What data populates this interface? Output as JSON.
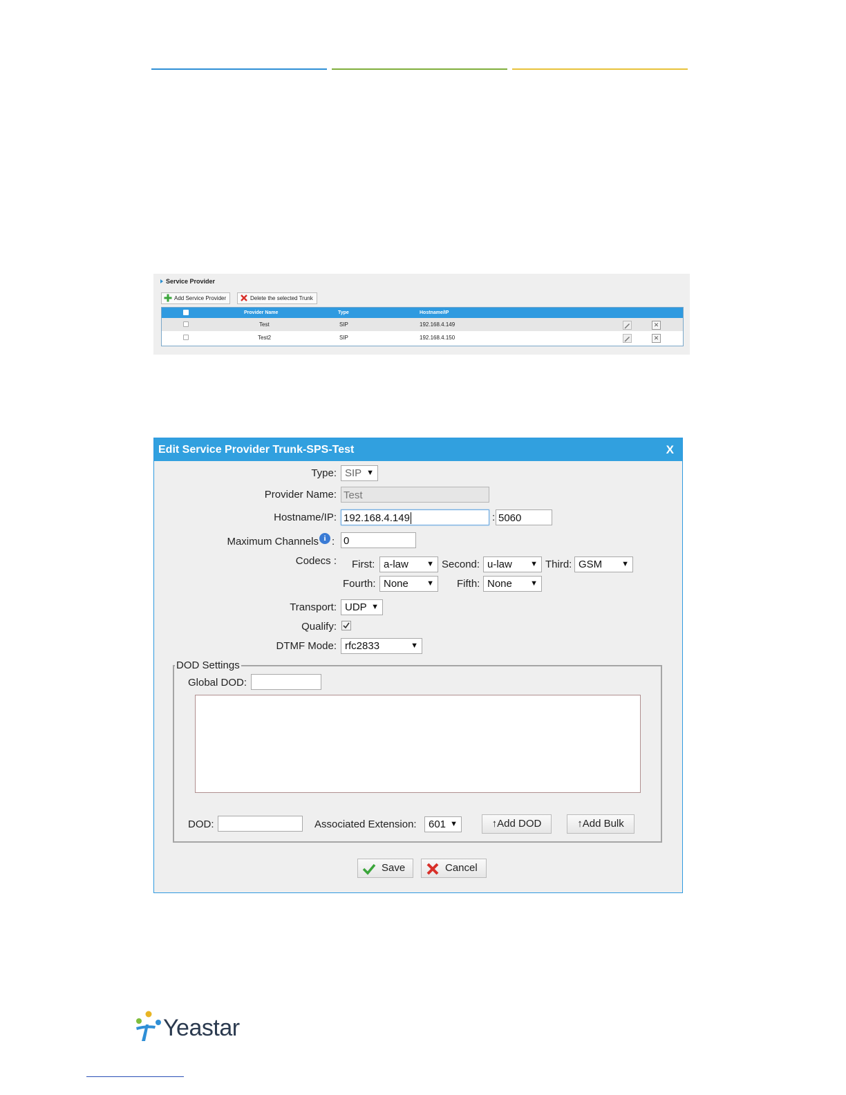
{
  "colors": {
    "line_blue": "#2f8fd6",
    "line_green": "#7fae3c",
    "line_yellow": "#e8c23a",
    "header_blue": "#31a0df",
    "logo_text": "#2b3a4f"
  },
  "service_provider": {
    "title": "Service Provider",
    "add_label": "Add Service Provider",
    "delete_label": "Delete the selected Trunk",
    "columns": [
      "Provider Name",
      "Type",
      "Hostname/IP"
    ],
    "rows": [
      {
        "name": "Test",
        "type": "SIP",
        "host": "192.168.4.149"
      },
      {
        "name": "Test2",
        "type": "SIP",
        "host": "192.168.4.150"
      }
    ]
  },
  "dialog": {
    "title": "Edit Service Provider Trunk-SPS-Test",
    "close": "X",
    "type_label": "Type:",
    "type_value": "SIP",
    "provider_name_label": "Provider Name:",
    "provider_name_value": "Test",
    "hostname_label": "Hostname/IP:",
    "hostname_value": "192.168.4.149",
    "port_sep": ":",
    "port_value": "5060",
    "max_channels_label": "Maximum Channels",
    "max_channels_colon": ":",
    "max_channels_value": "0",
    "codecs_label": "Codecs :",
    "first_label": "First:",
    "first_value": "a-law",
    "second_label": "Second:",
    "second_value": "u-law",
    "third_label": "Third:",
    "third_value": "GSM",
    "fourth_label": "Fourth:",
    "fourth_value": "None",
    "fifth_label": "Fifth:",
    "fifth_value": "None",
    "transport_label": "Transport:",
    "transport_value": "UDP",
    "qualify_label": "Qualify:",
    "qualify_checked": true,
    "dtmf_label": "DTMF Mode:",
    "dtmf_value": "rfc2833",
    "dod_settings_legend": "DOD Settings",
    "global_dod_label": "Global DOD:",
    "dod_label": "DOD:",
    "assoc_ext_label": "Associated Extension:",
    "assoc_ext_value": "601",
    "add_dod_label": "↑Add DOD",
    "add_bulk_label": "↑Add Bulk",
    "save_label": "Save",
    "cancel_label": "Cancel"
  },
  "logo": {
    "text": "Yeastar"
  }
}
